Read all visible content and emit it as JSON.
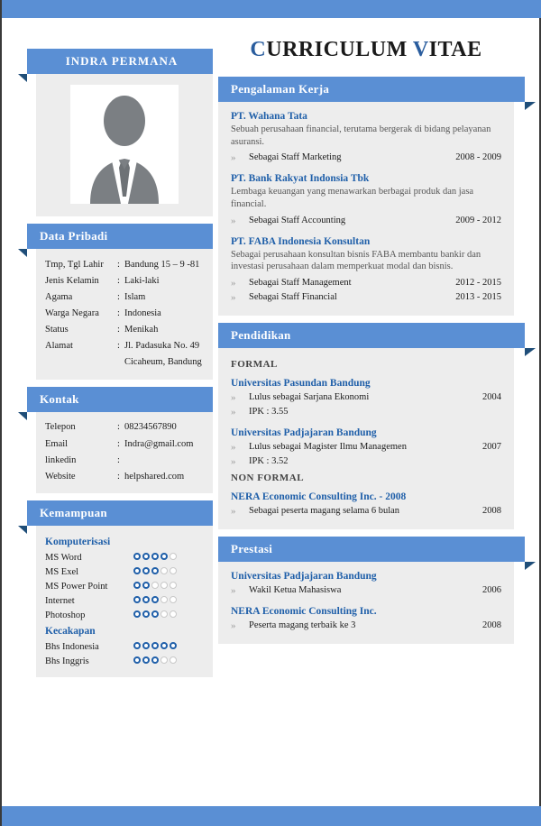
{
  "header": {
    "title_part1": "C",
    "title_part2": "URRICULUM ",
    "title_part3": "V",
    "title_part4": "ITAE",
    "accent_color": "#2a5d9e"
  },
  "theme": {
    "ribbon_blue": "#5a8fd4",
    "fold_navy": "#1f4e79",
    "panel_grey": "#ededed",
    "heading_blue": "#1f5fa9"
  },
  "sidebar": {
    "name_ribbon": "INDRA PERMANA",
    "photo_alt": "avatar-silhouette",
    "personal": {
      "heading": "Data Pribadi",
      "rows": [
        {
          "key": "Tmp, Tgl Lahir",
          "sep": ":",
          "value": "Bandung 15 – 9 -81"
        },
        {
          "key": "Jenis Kelamin",
          "sep": ":",
          "value": "Laki-laki"
        },
        {
          "key": "Agama",
          "sep": ":",
          "value": "Islam"
        },
        {
          "key": "Warga Negara",
          "sep": ":",
          "value": "Indonesia"
        },
        {
          "key": "Status",
          "sep": ":",
          "value": "Menikah"
        },
        {
          "key": "Alamat",
          "sep": ":",
          "value": "Jl.  Padasuka No. 49"
        },
        {
          "key": "",
          "sep": "",
          "value": "Cicaheum, Bandung"
        }
      ]
    },
    "contact": {
      "heading": "Kontak",
      "rows": [
        {
          "key": "Telepon",
          "sep": ":",
          "value": "08234567890"
        },
        {
          "key": "Email",
          "sep": ":",
          "value": "Indra@gmail.com"
        },
        {
          "key": "linkedin",
          "sep": ":",
          "value": ""
        },
        {
          "key": "Website",
          "sep": ":",
          "value": "helpshared.com"
        }
      ]
    },
    "skills": {
      "heading": "Kemampuan",
      "groups": [
        {
          "label": "Komputerisasi",
          "items": [
            {
              "name": "MS Word",
              "rating": 4,
              "max": 5
            },
            {
              "name": "MS Exel",
              "rating": 3,
              "max": 5
            },
            {
              "name": "MS Power Point",
              "rating": 2,
              "max": 5
            },
            {
              "name": "Internet",
              "rating": 3,
              "max": 5
            },
            {
              "name": "Photoshop",
              "rating": 3,
              "max": 5
            }
          ]
        },
        {
          "label": "Kecakapan",
          "items": [
            {
              "name": "Bhs Indonesia",
              "rating": 5,
              "max": 5
            },
            {
              "name": "Bhs Inggris",
              "rating": 3,
              "max": 5
            }
          ]
        }
      ]
    }
  },
  "main": {
    "experience": {
      "heading": "Pengalaman Kerja",
      "entries": [
        {
          "org": "PT. Wahana Tata",
          "desc": "Sebuah perusahaan financial, terutama bergerak di bidang pelayanan asuransi.",
          "items": [
            {
              "bullet": "»",
              "text": "Sebagai Staff Marketing",
              "year": "2008 - 2009"
            }
          ]
        },
        {
          "org": "PT. Bank Rakyat Indonsia Tbk",
          "desc": "Lembaga keuangan yang menawarkan berbagai produk dan jasa financial.",
          "items": [
            {
              "bullet": "»",
              "text": "Sebagai Staff Accounting",
              "year": "2009 - 2012"
            }
          ]
        },
        {
          "org": "PT. FABA Indonesia Konsultan",
          "desc": "Sebagai perusahaan konsultan bisnis FABA membantu bankir dan investasi perusahaan dalam memperkuat modal dan bisnis.",
          "items": [
            {
              "bullet": "»",
              "text": "Sebagai Staff Management",
              "year": "2012 - 2015"
            },
            {
              "bullet": "»",
              "text": "Sebagai Staff Financial",
              "year": "2013 - 2015"
            }
          ]
        }
      ]
    },
    "education": {
      "heading": "Pendidikan",
      "formal_label": "FORMAL",
      "formal": [
        {
          "org": "Universitas Pasundan Bandung",
          "items": [
            {
              "bullet": "»",
              "text": "Lulus sebagai Sarjana Ekonomi",
              "year": "2004"
            },
            {
              "bullet": "»",
              "text": "IPK : 3.55",
              "year": ""
            }
          ]
        },
        {
          "org": "Universitas Padjajaran Bandung",
          "items": [
            {
              "bullet": "»",
              "text": "Lulus sebagai Magister Ilmu Managemen",
              "year": "2007"
            },
            {
              "bullet": "»",
              "text": "IPK : 3.52",
              "year": ""
            }
          ]
        }
      ],
      "nonformal_label": "NON FORMAL",
      "nonformal": [
        {
          "org": "NERA Economic Consulting Inc. - 2008",
          "items": [
            {
              "bullet": "»",
              "text": "Sebagai peserta magang selama 6 bulan",
              "year": "2008"
            }
          ]
        }
      ]
    },
    "achievements": {
      "heading": "Prestasi",
      "entries": [
        {
          "org": "Universitas Padjajaran Bandung",
          "items": [
            {
              "bullet": "»",
              "text": "Wakil Ketua Mahasiswa",
              "year": "2006"
            }
          ]
        },
        {
          "org": "NERA Economic Consulting Inc.",
          "items": [
            {
              "bullet": "»",
              "text": "Peserta magang terbaik ke 3",
              "year": "2008"
            }
          ]
        }
      ]
    }
  }
}
